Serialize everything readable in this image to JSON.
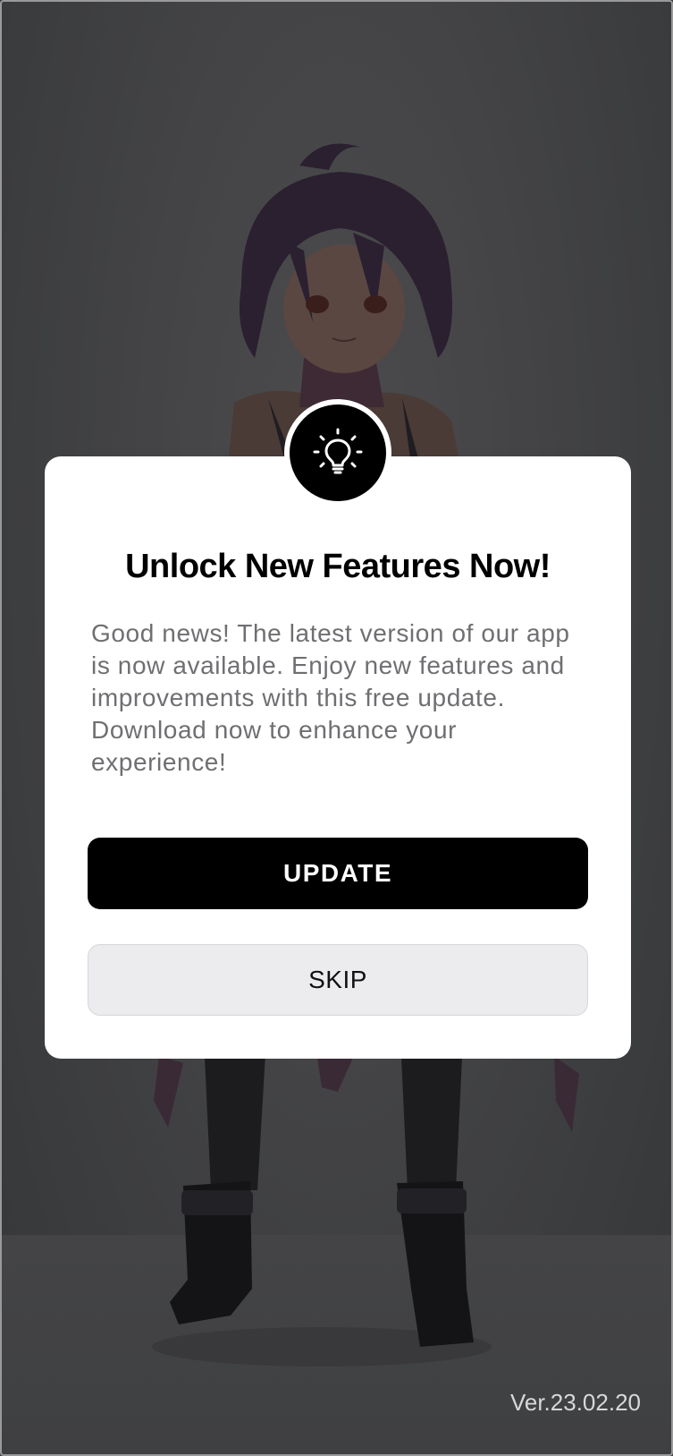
{
  "dialog": {
    "icon": "lightbulb-icon",
    "title": "Unlock New Features Now!",
    "message": "Good news! The latest version of our app is now available. Enjoy new features and improvements with this free update. Download now to enhance your experience!",
    "update_label": "UPDATE",
    "skip_label": "SKIP"
  },
  "version": "Ver.23.02.20",
  "background": {
    "image": "anime-girl-character-illustration"
  },
  "colors": {
    "primary_button": "#000000",
    "secondary_button": "#ECECEE",
    "overlay": "#3F4042"
  }
}
